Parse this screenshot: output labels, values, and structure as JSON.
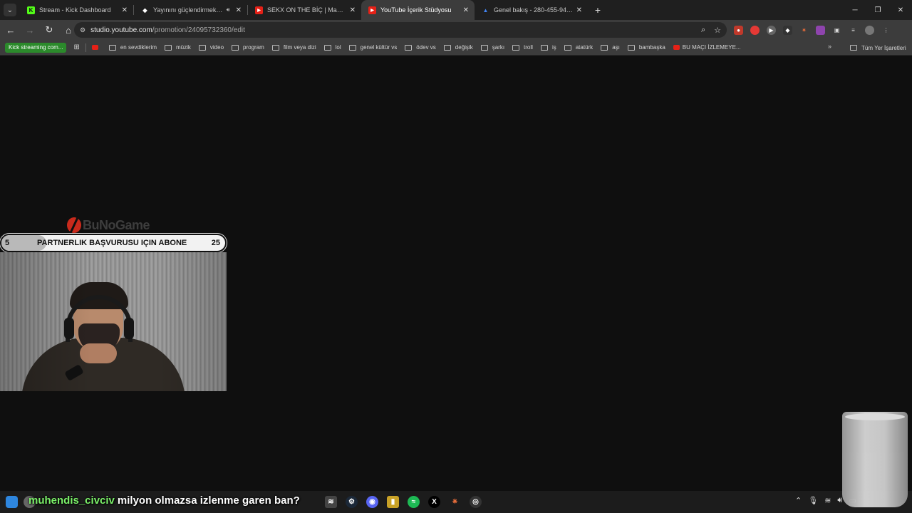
{
  "browser": {
    "tab_search_icon": "chevron-down-icon",
    "tabs": [
      {
        "title": "Stream - Kick Dashboard",
        "favicon": "kick-icon",
        "favicon_color": "#53fc18",
        "active": false
      },
      {
        "title": "Yayınını güçlendirmek için e",
        "favicon": "diamond-icon",
        "favicon_color": "#ffffff",
        "audio_icon": "speaker-icon",
        "active": false
      },
      {
        "title": "SEKX ON THE BİÇ | Madara Old",
        "favicon": "youtube-icon",
        "favicon_color": "#e62117",
        "active": false
      },
      {
        "title": "YouTube İçerik Stüdyosu",
        "favicon": "youtube-icon",
        "favicon_color": "#e62117",
        "active": true
      },
      {
        "title": "Genel bakış - 280-455-9452 - G",
        "favicon": "google-ads-icon",
        "favicon_color": "#4285f4",
        "active": false
      }
    ],
    "new_tab": "+",
    "window_controls": [
      "─",
      "❐",
      "✕"
    ],
    "url_host": "studio.youtube.com",
    "url_path": "/promotion/24095732360/edit",
    "bookmarks": {
      "kick": "Kick streaming com...",
      "items": [
        {
          "label": "",
          "type": "youtube"
        },
        {
          "label": "en sevdiklerim",
          "type": "folder"
        },
        {
          "label": "müzik",
          "type": "folder"
        },
        {
          "label": "video",
          "type": "folder"
        },
        {
          "label": "program",
          "type": "folder"
        },
        {
          "label": "film veya dizi",
          "type": "folder"
        },
        {
          "label": "lol",
          "type": "folder"
        },
        {
          "label": "genel kültür vs",
          "type": "folder"
        },
        {
          "label": "ödev vs",
          "type": "folder"
        },
        {
          "label": "değişik",
          "type": "folder"
        },
        {
          "label": "şarkı",
          "type": "folder"
        },
        {
          "label": "troll",
          "type": "folder"
        },
        {
          "label": "iş",
          "type": "folder"
        },
        {
          "label": "atatürk",
          "type": "folder"
        },
        {
          "label": "aşı",
          "type": "folder"
        },
        {
          "label": "bambaşka",
          "type": "folder"
        },
        {
          "label": "BU MAÇI İZLEMEYE...",
          "type": "youtube"
        }
      ],
      "more": "»",
      "all": "Tüm Yer İşaretleri"
    }
  },
  "overlay": {
    "logo_text": "BuNoGame",
    "goal": {
      "start": "5",
      "text": "PARTNERLIK BAŞVURUSU IÇIN ABONE",
      "end": "25",
      "progress_fraction": 0.2
    }
  },
  "chat": {
    "username": "muhendis_civciv",
    "message": "milyon olmazsa izlenme garen ban?"
  },
  "colors": {
    "accent_kick": "#53fc18",
    "youtube_red": "#e62117",
    "chat_user": "#7cf26a"
  }
}
